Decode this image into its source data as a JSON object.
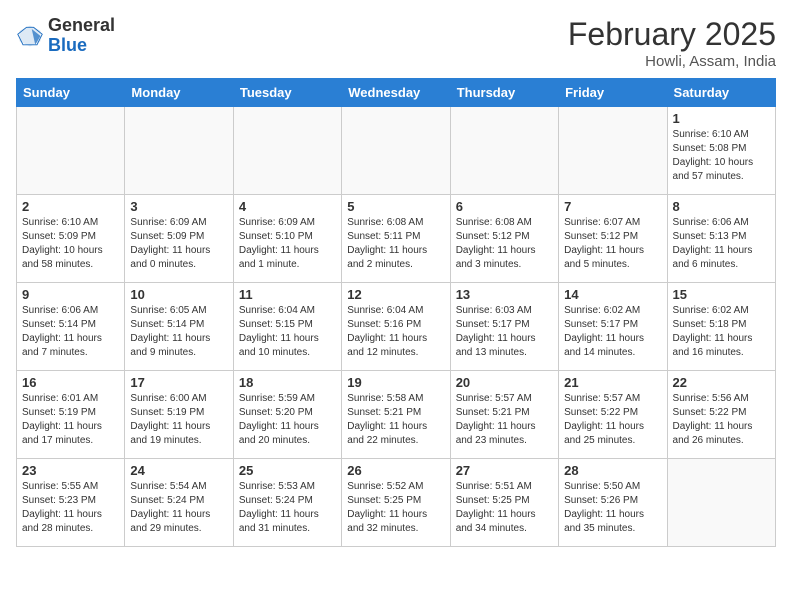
{
  "header": {
    "logo_general": "General",
    "logo_blue": "Blue",
    "month_title": "February 2025",
    "location": "Howli, Assam, India"
  },
  "weekdays": [
    "Sunday",
    "Monday",
    "Tuesday",
    "Wednesday",
    "Thursday",
    "Friday",
    "Saturday"
  ],
  "days": [
    {
      "num": "",
      "info": ""
    },
    {
      "num": "",
      "info": ""
    },
    {
      "num": "",
      "info": ""
    },
    {
      "num": "",
      "info": ""
    },
    {
      "num": "",
      "info": ""
    },
    {
      "num": "",
      "info": ""
    },
    {
      "num": "1",
      "info": "Sunrise: 6:10 AM\nSunset: 5:08 PM\nDaylight: 10 hours and 57 minutes."
    },
    {
      "num": "2",
      "info": "Sunrise: 6:10 AM\nSunset: 5:09 PM\nDaylight: 10 hours and 58 minutes."
    },
    {
      "num": "3",
      "info": "Sunrise: 6:09 AM\nSunset: 5:09 PM\nDaylight: 11 hours and 0 minutes."
    },
    {
      "num": "4",
      "info": "Sunrise: 6:09 AM\nSunset: 5:10 PM\nDaylight: 11 hours and 1 minute."
    },
    {
      "num": "5",
      "info": "Sunrise: 6:08 AM\nSunset: 5:11 PM\nDaylight: 11 hours and 2 minutes."
    },
    {
      "num": "6",
      "info": "Sunrise: 6:08 AM\nSunset: 5:12 PM\nDaylight: 11 hours and 3 minutes."
    },
    {
      "num": "7",
      "info": "Sunrise: 6:07 AM\nSunset: 5:12 PM\nDaylight: 11 hours and 5 minutes."
    },
    {
      "num": "8",
      "info": "Sunrise: 6:06 AM\nSunset: 5:13 PM\nDaylight: 11 hours and 6 minutes."
    },
    {
      "num": "9",
      "info": "Sunrise: 6:06 AM\nSunset: 5:14 PM\nDaylight: 11 hours and 7 minutes."
    },
    {
      "num": "10",
      "info": "Sunrise: 6:05 AM\nSunset: 5:14 PM\nDaylight: 11 hours and 9 minutes."
    },
    {
      "num": "11",
      "info": "Sunrise: 6:04 AM\nSunset: 5:15 PM\nDaylight: 11 hours and 10 minutes."
    },
    {
      "num": "12",
      "info": "Sunrise: 6:04 AM\nSunset: 5:16 PM\nDaylight: 11 hours and 12 minutes."
    },
    {
      "num": "13",
      "info": "Sunrise: 6:03 AM\nSunset: 5:17 PM\nDaylight: 11 hours and 13 minutes."
    },
    {
      "num": "14",
      "info": "Sunrise: 6:02 AM\nSunset: 5:17 PM\nDaylight: 11 hours and 14 minutes."
    },
    {
      "num": "15",
      "info": "Sunrise: 6:02 AM\nSunset: 5:18 PM\nDaylight: 11 hours and 16 minutes."
    },
    {
      "num": "16",
      "info": "Sunrise: 6:01 AM\nSunset: 5:19 PM\nDaylight: 11 hours and 17 minutes."
    },
    {
      "num": "17",
      "info": "Sunrise: 6:00 AM\nSunset: 5:19 PM\nDaylight: 11 hours and 19 minutes."
    },
    {
      "num": "18",
      "info": "Sunrise: 5:59 AM\nSunset: 5:20 PM\nDaylight: 11 hours and 20 minutes."
    },
    {
      "num": "19",
      "info": "Sunrise: 5:58 AM\nSunset: 5:21 PM\nDaylight: 11 hours and 22 minutes."
    },
    {
      "num": "20",
      "info": "Sunrise: 5:57 AM\nSunset: 5:21 PM\nDaylight: 11 hours and 23 minutes."
    },
    {
      "num": "21",
      "info": "Sunrise: 5:57 AM\nSunset: 5:22 PM\nDaylight: 11 hours and 25 minutes."
    },
    {
      "num": "22",
      "info": "Sunrise: 5:56 AM\nSunset: 5:22 PM\nDaylight: 11 hours and 26 minutes."
    },
    {
      "num": "23",
      "info": "Sunrise: 5:55 AM\nSunset: 5:23 PM\nDaylight: 11 hours and 28 minutes."
    },
    {
      "num": "24",
      "info": "Sunrise: 5:54 AM\nSunset: 5:24 PM\nDaylight: 11 hours and 29 minutes."
    },
    {
      "num": "25",
      "info": "Sunrise: 5:53 AM\nSunset: 5:24 PM\nDaylight: 11 hours and 31 minutes."
    },
    {
      "num": "26",
      "info": "Sunrise: 5:52 AM\nSunset: 5:25 PM\nDaylight: 11 hours and 32 minutes."
    },
    {
      "num": "27",
      "info": "Sunrise: 5:51 AM\nSunset: 5:25 PM\nDaylight: 11 hours and 34 minutes."
    },
    {
      "num": "28",
      "info": "Sunrise: 5:50 AM\nSunset: 5:26 PM\nDaylight: 11 hours and 35 minutes."
    },
    {
      "num": "",
      "info": ""
    },
    {
      "num": "",
      "info": ""
    },
    {
      "num": "",
      "info": ""
    },
    {
      "num": "",
      "info": ""
    },
    {
      "num": "",
      "info": ""
    },
    {
      "num": "",
      "info": ""
    },
    {
      "num": "",
      "info": ""
    },
    {
      "num": "",
      "info": ""
    },
    {
      "num": "",
      "info": ""
    },
    {
      "num": "",
      "info": ""
    },
    {
      "num": "",
      "info": ""
    },
    {
      "num": "",
      "info": ""
    },
    {
      "num": "",
      "info": ""
    },
    {
      "num": "",
      "info": ""
    }
  ]
}
